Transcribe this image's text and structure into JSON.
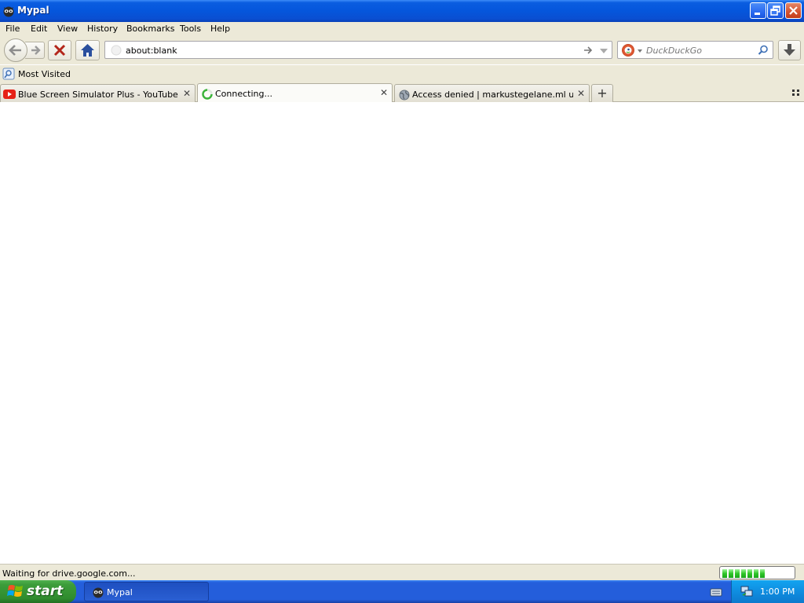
{
  "window": {
    "title": "Mypal"
  },
  "menu": [
    "File",
    "Edit",
    "View",
    "History",
    "Bookmarks",
    "Tools",
    "Help"
  ],
  "navbar": {
    "url": "about:blank",
    "search_placeholder": "DuckDuckGo"
  },
  "bookmarks": {
    "most_visited": "Most Visited"
  },
  "tabs": [
    {
      "label": "Blue Screen Simulator Plus - YouTube",
      "icon": "youtube-icon"
    },
    {
      "label": "Connecting...",
      "icon": "loading-spinner-icon",
      "active": true
    },
    {
      "label": "Access denied | markustegelane.ml used ...",
      "icon": "globe-icon"
    }
  ],
  "status": {
    "text": "Waiting for drive.google.com...",
    "progress_fraction": 0.6
  },
  "taskbar": {
    "start_label": "start",
    "task_label": "Mypal",
    "clock": "1:00 PM"
  },
  "colors": {
    "titlebar": "#0556dc",
    "chrome": "#ece9d8",
    "taskbar": "#245edb",
    "start": "#3c9c3a",
    "close": "#d4522f",
    "youtube": "#e62117",
    "progress": "#2fc628"
  }
}
